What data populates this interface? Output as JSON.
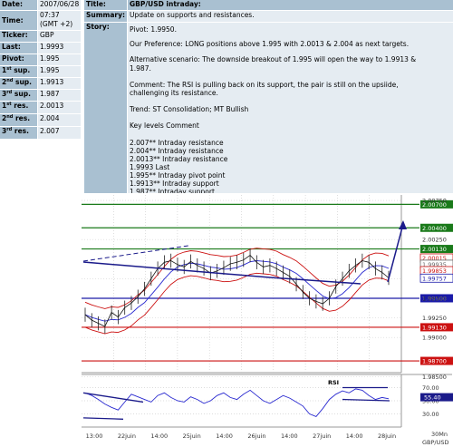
{
  "info_table": {
    "date": {
      "label": "Date:",
      "value": "2007/06/28"
    },
    "time": {
      "label": "Time:",
      "value_line1": "07:37",
      "value_line2": "(GMT +2)"
    },
    "ticker": {
      "label": "Ticker:",
      "value": "GBP"
    },
    "last": {
      "label": "Last:",
      "value": "1.9993"
    },
    "pivot": {
      "label": "Pivot:",
      "value": "1.995"
    },
    "sup1": {
      "ordinal": "1",
      "suffix": "st",
      "label": "sup.",
      "value": "1.995"
    },
    "sup2": {
      "ordinal": "2",
      "suffix": "nd",
      "label": "sup.",
      "value": "1.9913"
    },
    "sup3": {
      "ordinal": "3",
      "suffix": "rd",
      "label": "sup.",
      "value": "1.987"
    },
    "res1": {
      "ordinal": "1",
      "suffix": "st",
      "label": "res.",
      "value": "2.0013"
    },
    "res2": {
      "ordinal": "2",
      "suffix": "nd",
      "label": "res.",
      "value": "2.004"
    },
    "res3": {
      "ordinal": "3",
      "suffix": "rd",
      "label": "res.",
      "value": "2.007"
    }
  },
  "article": {
    "title_label": "Title:",
    "title": "GBP/USD intraday:",
    "summary_label": "Summary:",
    "summary": "Update on supports and resistances.",
    "story_label": "Story:",
    "story_lines": [
      "Pivot: 1.9950.",
      "Our Preference: LONG positions above 1.995 with 2.0013 & 2.004 as next targets.",
      "Alternative scenario: The downside breakout of 1.995 will open the way to 1.9913 &",
      "1.987.",
      "Comment: The RSI is pulling back on its support, the pair is still on the upsiide,",
      "challenging its resistance.",
      "Trend: ST Consolidation; MT Bullish",
      "Key levels Comment",
      "2.007** Intraday resistance",
      "2.004** Intraday resistance",
      "2.0013** Intraday resistance",
      "1.9993 Last",
      "1.995** Intraday pivot point",
      "1.9913** Intraday support",
      "1.987** Intraday support"
    ]
  },
  "chart_data": {
    "type": "line",
    "title": "",
    "instrument_label": "GBP/USD",
    "timeframe_label": "30Mn",
    "x_tick_labels": [
      "13:00",
      "22juin",
      "14:00",
      "25juin",
      "14:00",
      "26juin",
      "14:00",
      "27juin",
      "14:00",
      "28juin"
    ],
    "y_tick_labels": [
      "2.00750",
      "2.00250",
      "1.99750",
      "1.99500",
      "1.99250",
      "1.99000",
      "1.98500"
    ],
    "ylim": [
      1.9855,
      2.0082
    ],
    "levels": [
      {
        "value": 2.007,
        "label": "2.00700",
        "color": "#1a7a1a",
        "role": "resistance"
      },
      {
        "value": 2.004,
        "label": "2.00400",
        "color": "#1a7a1a",
        "role": "resistance"
      },
      {
        "value": 2.0013,
        "label": "2.00130",
        "color": "#1a7a1a",
        "role": "resistance"
      },
      {
        "value": 1.995,
        "label": "1.99500",
        "color": "#1a1aa8",
        "role": "pivot"
      },
      {
        "value": 1.9913,
        "label": "1.99130",
        "color": "#cc1111",
        "role": "support"
      },
      {
        "value": 1.987,
        "label": "1.98700",
        "color": "#cc1111",
        "role": "support"
      }
    ],
    "price_tags": [
      {
        "value": 2.00015,
        "label": "2.00015",
        "color": "#cc1111"
      },
      {
        "value": 1.99935,
        "label": "1.99935",
        "color": "#666666"
      },
      {
        "value": 1.99853,
        "label": "1.99853",
        "color": "#cc1111"
      },
      {
        "value": 1.99757,
        "label": "1.99757",
        "color": "#1a1aa8"
      }
    ],
    "close_series": [
      1.9929,
      1.9922,
      1.9918,
      1.9914,
      1.9932,
      1.9926,
      1.9938,
      1.9944,
      1.9952,
      1.9962,
      1.9975,
      1.9988,
      1.9996,
      1.9998,
      1.9993,
      1.999,
      1.9997,
      1.9992,
      1.9988,
      1.9982,
      1.9985,
      1.9989,
      1.9994,
      1.9996,
      1.9999,
      2.0005,
      1.9996,
      1.999,
      1.9992,
      1.9988,
      1.9983,
      1.9978,
      1.9968,
      1.9958,
      1.995,
      1.9946,
      1.9943,
      1.995,
      1.9965,
      1.9975,
      1.9985,
      1.9992,
      1.9998,
      1.9996,
      1.9988,
      1.9983,
      1.9976
    ],
    "rsi": {
      "label": "RSI",
      "value_label": "55.40",
      "levels": [
        {
          "label": "70.00",
          "value": 70
        },
        {
          "label": "50.00",
          "value": 50
        },
        {
          "label": "30.00",
          "value": 30
        }
      ],
      "series": [
        62,
        58,
        52,
        45,
        40,
        36,
        48,
        60,
        56,
        52,
        48,
        58,
        62,
        55,
        50,
        48,
        56,
        52,
        46,
        50,
        58,
        62,
        55,
        52,
        60,
        66,
        58,
        50,
        46,
        52,
        58,
        54,
        48,
        42,
        30,
        26,
        38,
        52,
        60,
        65,
        62,
        68,
        66,
        58,
        52,
        55,
        53
      ]
    }
  }
}
